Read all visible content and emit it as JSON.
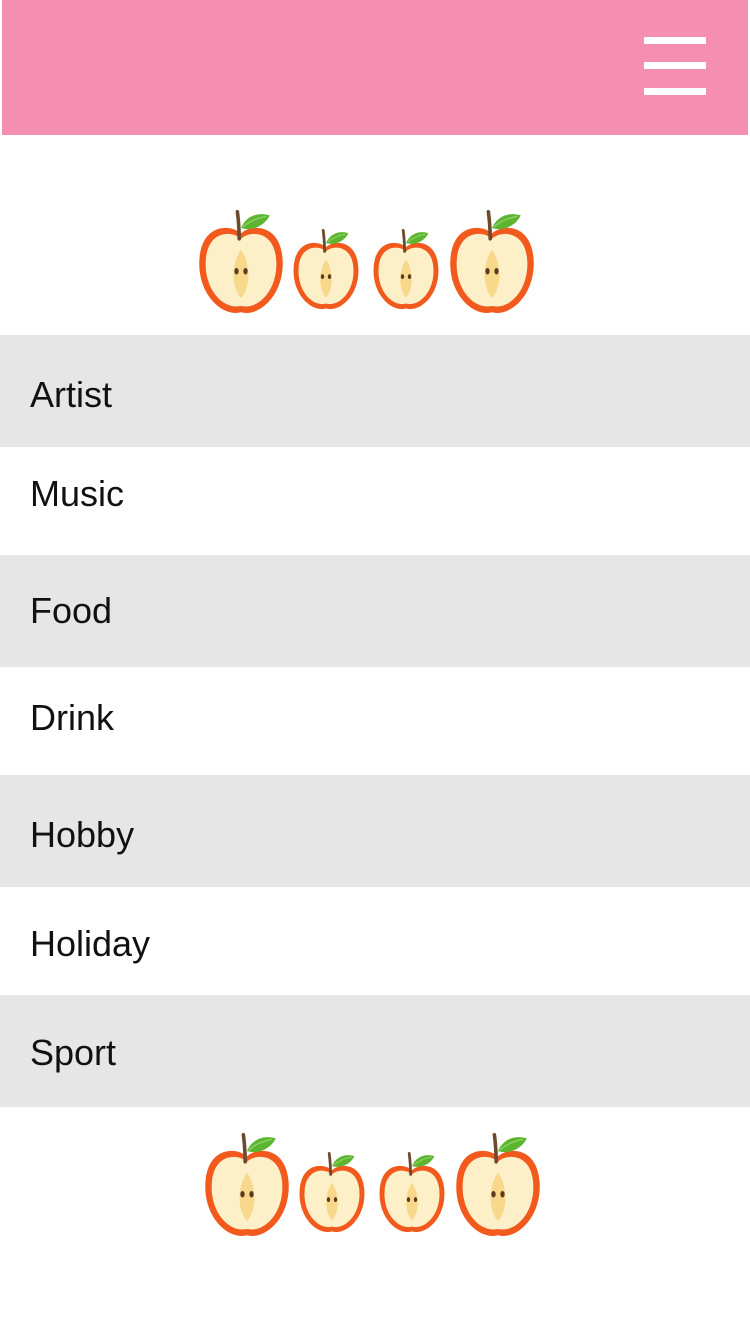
{
  "header": {
    "background": "#f48fb1",
    "menu_icon": "hamburger-menu-icon"
  },
  "decoration": {
    "icon": "apple-half-icon",
    "colors": {
      "skin": "#f25a1d",
      "flesh": "#fdf0c9",
      "core": "#f8d88a",
      "leaf": "#5cb531",
      "stem": "#6b4a2e",
      "seed": "#5a3b22"
    }
  },
  "menu": {
    "stripe_color": "#e6e6e6",
    "items": [
      {
        "label": "Artist"
      },
      {
        "label": "Music"
      },
      {
        "label": "Food"
      },
      {
        "label": "Drink"
      },
      {
        "label": "Hobby"
      },
      {
        "label": "Holiday"
      },
      {
        "label": "Sport"
      }
    ]
  }
}
